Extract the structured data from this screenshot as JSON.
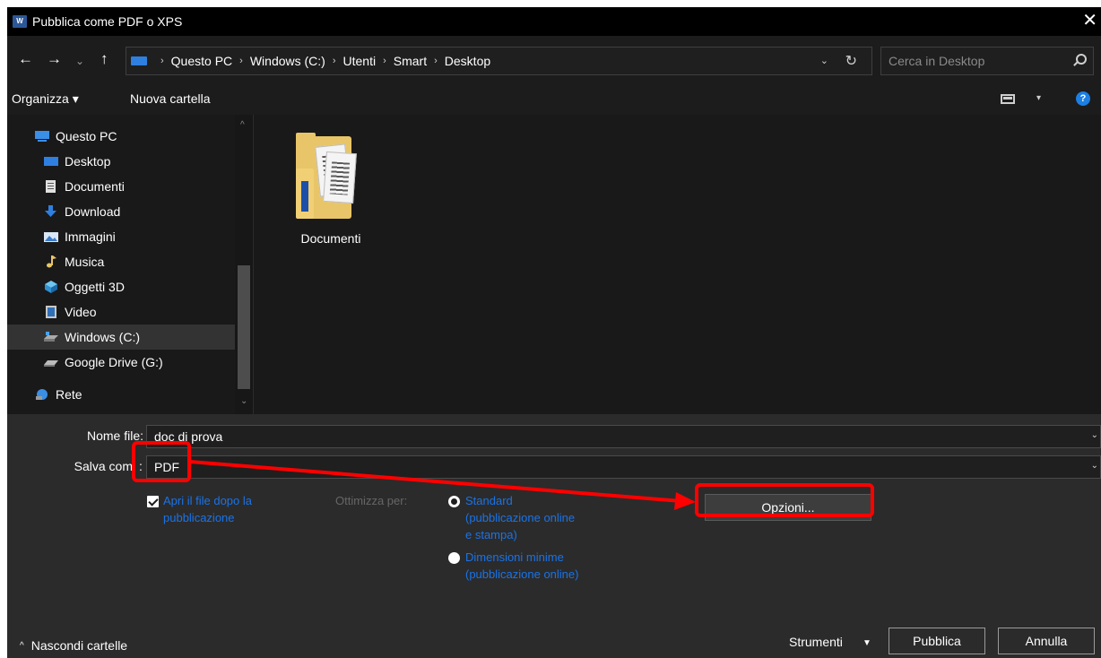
{
  "window": {
    "title": "Pubblica come PDF o XPS",
    "app_icon_text": "W",
    "close_glyph": "✕"
  },
  "nav": {
    "back_glyph": "←",
    "forward_glyph": "→",
    "recent_glyph": "⌄",
    "up_glyph": "↑",
    "breadcrumbs": [
      "Questo PC",
      "Windows (C:)",
      "Utenti",
      "Smart",
      "Desktop"
    ],
    "crumb_separator": "›",
    "address_dropdown_glyph": "⌄",
    "refresh_glyph": "↻",
    "search_placeholder": "Cerca in Desktop"
  },
  "toolbar": {
    "organize_label": "Organizza ▾",
    "new_folder_label": "Nuova cartella",
    "help_glyph": "?",
    "view_dropdown_glyph": "▾"
  },
  "sidebar": {
    "items": [
      {
        "label": "Questo PC",
        "icon": "computer-icon"
      },
      {
        "label": "Desktop",
        "icon": "desktop-icon"
      },
      {
        "label": "Documenti",
        "icon": "documents-icon"
      },
      {
        "label": "Download",
        "icon": "download-icon"
      },
      {
        "label": "Immagini",
        "icon": "pictures-icon"
      },
      {
        "label": "Musica",
        "icon": "music-icon"
      },
      {
        "label": "Oggetti 3D",
        "icon": "objects-3d-icon"
      },
      {
        "label": "Video",
        "icon": "video-icon"
      },
      {
        "label": "Windows (C:)",
        "icon": "drive-icon",
        "selected": true
      },
      {
        "label": "Google Drive (G:)",
        "icon": "google-drive-icon"
      },
      {
        "label": "Rete",
        "icon": "network-icon"
      }
    ],
    "scroll_up_glyph": "^",
    "scroll_down_glyph": "⌄"
  },
  "content": {
    "items": [
      {
        "label": "Documenti",
        "icon": "folder-icon"
      }
    ]
  },
  "form": {
    "filename_label": "Nome file:",
    "filename_value": "doc di prova",
    "savetype_label_visible": "Salva com",
    "savetype_label_after": ":",
    "savetype_value": "PDF",
    "dropdown_glyph": "⌄",
    "open_after_publish_line1": "Apri il file dopo la",
    "open_after_publish_line2": "pubblicazione",
    "open_after_publish_checked": true,
    "optimize_label": "Ottimizza per:",
    "option_standard_lines": [
      "Standard",
      "(pubblicazione online",
      "e stampa)"
    ],
    "option_minimum_lines": [
      "Dimensioni minime",
      "(pubblicazione online)"
    ],
    "selected_option": "Standard",
    "options_button": "Opzioni..."
  },
  "footer": {
    "hide_folders_chevron": "^",
    "hide_folders": "Nascondi cartelle",
    "tools_label": "Strumenti",
    "tools_dropdown_glyph": "▼",
    "publish_button": "Pubblica",
    "cancel_button": "Annulla"
  },
  "colors": {
    "background": "#191919",
    "panel": "#2b2b2b",
    "link": "#1a73e8",
    "annotation": "#ff0000",
    "accent": "#1c7fe3"
  }
}
